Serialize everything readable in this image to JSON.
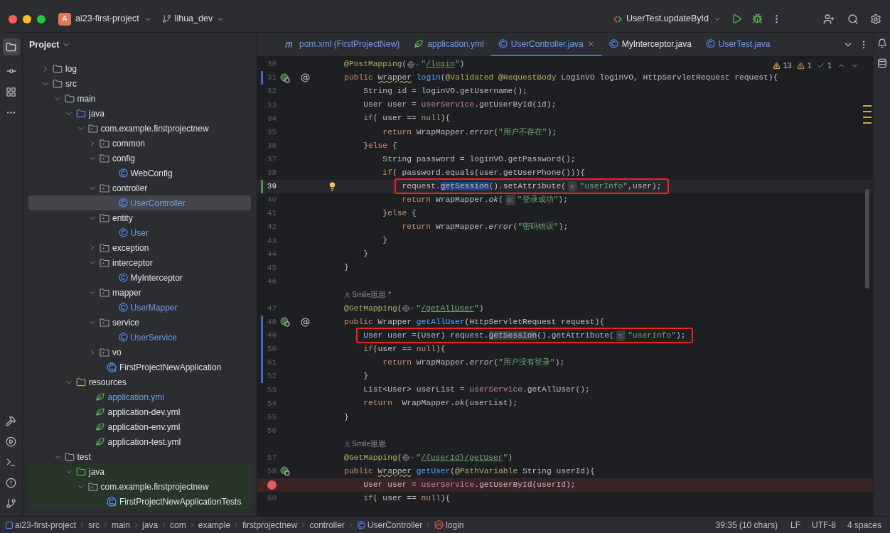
{
  "title_bar": {
    "project": {
      "badge": "A",
      "name": "ai23-first-project"
    },
    "branch": "lihua_dev",
    "run_config": "UserTest.updateById"
  },
  "project_panel": {
    "title": "Project",
    "tree": [
      {
        "label": "log",
        "kind": "folder",
        "expanded": false,
        "selected": false,
        "modified": false
      },
      {
        "label": "src",
        "kind": "folder",
        "expanded": true,
        "selected": false,
        "modified": false,
        "children": [
          {
            "label": "main",
            "kind": "folder",
            "expanded": true,
            "selected": false,
            "modified": false,
            "children": [
              {
                "label": "java",
                "kind": "source",
                "expanded": true,
                "selected": false,
                "modified": false,
                "children": [
                  {
                    "label": "com.example.firstprojectnew",
                    "kind": "package",
                    "expanded": true,
                    "selected": false,
                    "modified": false,
                    "children": [
                      {
                        "label": "common",
                        "kind": "package",
                        "expanded": false,
                        "selected": false,
                        "modified": false
                      },
                      {
                        "label": "config",
                        "kind": "package",
                        "expanded": true,
                        "selected": false,
                        "modified": false,
                        "children": [
                          {
                            "label": "WebConfig",
                            "kind": "class",
                            "selected": false,
                            "modified": false
                          }
                        ]
                      },
                      {
                        "label": "controller",
                        "kind": "package",
                        "expanded": true,
                        "selected": false,
                        "modified": false,
                        "children": [
                          {
                            "label": "UserController",
                            "kind": "class",
                            "selected": true,
                            "modified": true
                          }
                        ]
                      },
                      {
                        "label": "entity",
                        "kind": "package",
                        "expanded": true,
                        "selected": false,
                        "modified": false,
                        "children": [
                          {
                            "label": "User",
                            "kind": "class",
                            "selected": false,
                            "modified": true
                          }
                        ]
                      },
                      {
                        "label": "exception",
                        "kind": "package",
                        "expanded": false,
                        "selected": false,
                        "modified": false
                      },
                      {
                        "label": "interceptor",
                        "kind": "package",
                        "expanded": true,
                        "selected": false,
                        "modified": false,
                        "children": [
                          {
                            "label": "MyInterceptor",
                            "kind": "class",
                            "selected": false,
                            "modified": false
                          }
                        ]
                      },
                      {
                        "label": "mapper",
                        "kind": "package",
                        "expanded": true,
                        "selected": false,
                        "modified": false,
                        "children": [
                          {
                            "label": "UserMapper",
                            "kind": "class",
                            "selected": false,
                            "modified": true
                          }
                        ]
                      },
                      {
                        "label": "service",
                        "kind": "package",
                        "expanded": true,
                        "selected": false,
                        "modified": false,
                        "children": [
                          {
                            "label": "UserService",
                            "kind": "class",
                            "selected": false,
                            "modified": true
                          }
                        ]
                      },
                      {
                        "label": "vo",
                        "kind": "package",
                        "expanded": false,
                        "selected": false,
                        "modified": false
                      },
                      {
                        "label": "FirstProjectNewApplication",
                        "kind": "app",
                        "selected": false,
                        "modified": false
                      }
                    ]
                  }
                ]
              },
              {
                "label": "resources",
                "kind": "resources",
                "expanded": true,
                "selected": false,
                "modified": false,
                "children": [
                  {
                    "label": "application.yml",
                    "kind": "yml",
                    "selected": false,
                    "modified": true
                  },
                  {
                    "label": "application-dev.yml",
                    "kind": "yml",
                    "selected": false,
                    "modified": false
                  },
                  {
                    "label": "application-env.yml",
                    "kind": "yml",
                    "selected": false,
                    "modified": false
                  },
                  {
                    "label": "application-test.yml",
                    "kind": "yml",
                    "selected": false,
                    "modified": false
                  }
                ]
              }
            ]
          },
          {
            "label": "test",
            "kind": "folder",
            "expanded": true,
            "selected": false,
            "modified": false,
            "children": [
              {
                "label": "java",
                "kind": "test-source",
                "expanded": true,
                "selected": false,
                "modified": false,
                "children": [
                  {
                    "label": "com.example.firstprojectnew",
                    "kind": "package",
                    "expanded": true,
                    "selected": false,
                    "modified": false,
                    "children": [
                      {
                        "label": "FirstProjectNewApplicationTests",
                        "kind": "app",
                        "selected": false,
                        "modified": false
                      }
                    ]
                  }
                ]
              }
            ]
          }
        ]
      }
    ]
  },
  "tabs": [
    {
      "label": "pom.xml (FirstProjectNew)",
      "kind": "maven",
      "selected": false,
      "modified": true
    },
    {
      "label": "application.yml",
      "kind": "yml",
      "selected": false,
      "modified": true
    },
    {
      "label": "UserController.java",
      "kind": "class",
      "selected": true,
      "modified": true
    },
    {
      "label": "MyInterceptor.java",
      "kind": "class",
      "selected": false,
      "modified": false
    },
    {
      "label": "UserTest.java",
      "kind": "class",
      "selected": false,
      "modified": true
    }
  ],
  "inspections": {
    "warnings": "13",
    "weak_warnings": "1",
    "typos": "1"
  },
  "editor": {
    "lines": [
      {
        "kind": "code",
        "no": "30",
        "tokens": [
          {
            "kind": "ann",
            "text": "    @PostMapping"
          },
          {
            "kind": "plain",
            "text": "("
          },
          {
            "kind": "globe"
          },
          {
            "kind": "str",
            "text": "\""
          },
          {
            "kind": "link",
            "text": "/login"
          },
          {
            "kind": "str",
            "text": "\""
          },
          {
            "kind": "plain",
            "text": ")"
          }
        ]
      },
      {
        "kind": "code",
        "no": "31",
        "marker": {
          "kind": "modified"
        },
        "gutter": [
          {
            "kind": "bean"
          },
          {
            "kind": "at"
          }
        ],
        "tokens": [
          {
            "kind": "kw",
            "text": "    public "
          },
          {
            "kind": "warn",
            "text": "Wrapper"
          },
          {
            "kind": "fn",
            "text": " login"
          },
          {
            "kind": "plain",
            "text": "("
          },
          {
            "kind": "ann",
            "text": "@Validated @RequestBody "
          },
          {
            "kind": "plain",
            "text": "LoginVO loginVO, HttpServletRequest request){"
          }
        ]
      },
      {
        "kind": "code",
        "no": "32",
        "tokens": [
          {
            "kind": "plain",
            "text": "        String id = loginVO.getUsername();"
          }
        ]
      },
      {
        "kind": "code",
        "no": "33",
        "tokens": [
          {
            "kind": "plain",
            "text": "        User user = "
          },
          {
            "kind": "field",
            "text": "userService"
          },
          {
            "kind": "plain",
            "text": ".getUserById(id);"
          }
        ]
      },
      {
        "kind": "code",
        "no": "34",
        "tokens": [
          {
            "kind": "kw",
            "text": "        if"
          },
          {
            "kind": "plain",
            "text": "( user == "
          },
          {
            "kind": "kw",
            "text": "null"
          },
          {
            "kind": "plain",
            "text": "){"
          }
        ]
      },
      {
        "kind": "code",
        "no": "35",
        "tokens": [
          {
            "kind": "kw",
            "text": "            return "
          },
          {
            "kind": "plain",
            "text": "WrapMapper."
          },
          {
            "kind": "italic",
            "text": "error"
          },
          {
            "kind": "plain",
            "text": "("
          },
          {
            "kind": "str",
            "text": "\"用户不存在\""
          },
          {
            "kind": "plain",
            "text": ");"
          }
        ]
      },
      {
        "kind": "code",
        "no": "36",
        "tokens": [
          {
            "kind": "plain",
            "text": "        }"
          },
          {
            "kind": "kw",
            "text": "else"
          },
          {
            "kind": "plain",
            "text": " {"
          }
        ]
      },
      {
        "kind": "code",
        "no": "37",
        "tokens": [
          {
            "kind": "plain",
            "text": "            String password = loginVO.getPassword();"
          }
        ]
      },
      {
        "kind": "code",
        "no": "38",
        "tokens": [
          {
            "kind": "kw",
            "text": "            if"
          },
          {
            "kind": "plain",
            "text": "( password.equals(user.getUserPhone())){"
          }
        ]
      },
      {
        "kind": "code",
        "no": "39",
        "row": {
          "kind": "current"
        },
        "frame": {
          "kind": "boxed"
        },
        "marker": {
          "kind": "added"
        },
        "gutter": [
          {
            "kind": "bulb"
          }
        ],
        "tokens": [
          {
            "kind": "plain",
            "text": "request."
          },
          {
            "kind": "sel",
            "text": "getSession"
          },
          {
            "kind": "plain",
            "text": "().setAttribute("
          },
          {
            "kind": "hint",
            "text": "s:"
          },
          {
            "kind": "str",
            "text": "\"userInfo\""
          },
          {
            "kind": "plain",
            "text": ",user);"
          }
        ]
      },
      {
        "kind": "code",
        "no": "40",
        "tokens": [
          {
            "kind": "kw",
            "text": "                return "
          },
          {
            "kind": "plain",
            "text": "WrapMapper."
          },
          {
            "kind": "italic",
            "text": "ok"
          },
          {
            "kind": "plain",
            "text": "("
          },
          {
            "kind": "hint",
            "text": "o:"
          },
          {
            "kind": "str",
            "text": "\"登录成功\""
          },
          {
            "kind": "plain",
            "text": ");"
          }
        ]
      },
      {
        "kind": "code",
        "no": "41",
        "tokens": [
          {
            "kind": "plain",
            "text": "            }"
          },
          {
            "kind": "kw",
            "text": "else"
          },
          {
            "kind": "plain",
            "text": " {"
          }
        ]
      },
      {
        "kind": "code",
        "no": "42",
        "tokens": [
          {
            "kind": "kw",
            "text": "                return "
          },
          {
            "kind": "plain",
            "text": "WrapMapper."
          },
          {
            "kind": "italic",
            "text": "error"
          },
          {
            "kind": "plain",
            "text": "("
          },
          {
            "kind": "str",
            "text": "\"密码错误\""
          },
          {
            "kind": "plain",
            "text": ");"
          }
        ]
      },
      {
        "kind": "code",
        "no": "43",
        "tokens": [
          {
            "kind": "plain",
            "text": "            }"
          }
        ]
      },
      {
        "kind": "code",
        "no": "44",
        "tokens": [
          {
            "kind": "plain",
            "text": "        }"
          }
        ]
      },
      {
        "kind": "code",
        "no": "45",
        "tokens": [
          {
            "kind": "plain",
            "text": "    }"
          }
        ]
      },
      {
        "kind": "code",
        "no": "46"
      },
      {
        "kind": "author",
        "text": "Smile崽崽 *"
      },
      {
        "kind": "code",
        "no": "47",
        "tokens": [
          {
            "kind": "ann",
            "text": "    @GetMapping"
          },
          {
            "kind": "plain",
            "text": "("
          },
          {
            "kind": "globe"
          },
          {
            "kind": "str",
            "text": "\""
          },
          {
            "kind": "link",
            "text": "/getAllUser"
          },
          {
            "kind": "str",
            "text": "\""
          },
          {
            "kind": "plain",
            "text": ")"
          }
        ]
      },
      {
        "kind": "code",
        "no": "48",
        "marker": {
          "kind": "modified"
        },
        "gutter": [
          {
            "kind": "bean"
          },
          {
            "kind": "at"
          }
        ],
        "tokens": [
          {
            "kind": "kw",
            "text": "    public "
          },
          {
            "kind": "plain",
            "text": "Wrapper "
          },
          {
            "kind": "fn",
            "text": "getAllUser"
          },
          {
            "kind": "plain",
            "text": "(HttpServletRequest request){"
          }
        ]
      },
      {
        "kind": "code",
        "no": "49",
        "frame": {
          "kind": "boxed"
        },
        "marker": {
          "kind": "modified"
        },
        "tokens": [
          {
            "kind": "plain",
            "text": "User user =(User) request."
          },
          {
            "kind": "usage",
            "text": "getSession"
          },
          {
            "kind": "plain",
            "text": "().getAttribute("
          },
          {
            "kind": "hint",
            "text": "s:"
          },
          {
            "kind": "str",
            "text": "\"userInfo\""
          },
          {
            "kind": "plain",
            "text": ");"
          }
        ]
      },
      {
        "kind": "code",
        "no": "50",
        "marker": {
          "kind": "modified"
        },
        "tokens": [
          {
            "kind": "kw",
            "text": "        if"
          },
          {
            "kind": "plain",
            "text": "(user == "
          },
          {
            "kind": "kw",
            "text": "null"
          },
          {
            "kind": "plain",
            "text": "){"
          }
        ]
      },
      {
        "kind": "code",
        "no": "51",
        "marker": {
          "kind": "modified"
        },
        "tokens": [
          {
            "kind": "kw",
            "text": "            return "
          },
          {
            "kind": "plain",
            "text": "WrapMapper."
          },
          {
            "kind": "italic",
            "text": "error"
          },
          {
            "kind": "plain",
            "text": "("
          },
          {
            "kind": "str",
            "text": "\"用户没有登录\""
          },
          {
            "kind": "plain",
            "text": ");"
          }
        ]
      },
      {
        "kind": "code",
        "no": "52",
        "marker": {
          "kind": "modified"
        },
        "tokens": [
          {
            "kind": "plain",
            "text": "        }"
          }
        ]
      },
      {
        "kind": "code",
        "no": "53",
        "tokens": [
          {
            "kind": "plain",
            "text": "        List<User> userList = "
          },
          {
            "kind": "field",
            "text": "userService"
          },
          {
            "kind": "plain",
            "text": ".getAllUser();"
          }
        ]
      },
      {
        "kind": "code",
        "no": "54",
        "tokens": [
          {
            "kind": "kw",
            "text": "        return  "
          },
          {
            "kind": "plain",
            "text": "WrapMapper."
          },
          {
            "kind": "italic",
            "text": "ok"
          },
          {
            "kind": "plain",
            "text": "(userList);"
          }
        ]
      },
      {
        "kind": "code",
        "no": "55",
        "tokens": [
          {
            "kind": "plain",
            "text": "    }"
          }
        ]
      },
      {
        "kind": "code",
        "no": "56"
      },
      {
        "kind": "author",
        "text": "Smile崽崽"
      },
      {
        "kind": "code",
        "no": "57",
        "tokens": [
          {
            "kind": "ann",
            "text": "    @GetMapping"
          },
          {
            "kind": "plain",
            "text": "("
          },
          {
            "kind": "globe"
          },
          {
            "kind": "str",
            "text": "\""
          },
          {
            "kind": "link",
            "text": "/{userId}/getUser"
          },
          {
            "kind": "str",
            "text": "\""
          },
          {
            "kind": "plain",
            "text": ")"
          }
        ]
      },
      {
        "kind": "code",
        "no": "58",
        "gutter": [
          {
            "kind": "bean"
          }
        ],
        "tokens": [
          {
            "kind": "kw",
            "text": "    public "
          },
          {
            "kind": "warn",
            "text": "Wrapper"
          },
          {
            "kind": "fn",
            "text": " getUser"
          },
          {
            "kind": "plain",
            "text": "("
          },
          {
            "kind": "ann",
            "text": "@PathVariable "
          },
          {
            "kind": "plain",
            "text": "String userId){"
          }
        ]
      },
      {
        "kind": "code",
        "row": {
          "kind": "breakpoint"
        },
        "tokens": [
          {
            "kind": "plain",
            "text": "        User user = "
          },
          {
            "kind": "field",
            "text": "userService"
          },
          {
            "kind": "plain",
            "text": ".getUserById(userId);"
          }
        ]
      },
      {
        "kind": "code",
        "no": "60",
        "tokens": [
          {
            "kind": "kw",
            "text": "        if"
          },
          {
            "kind": "plain",
            "text": "( user == "
          },
          {
            "kind": "kw",
            "text": "null"
          },
          {
            "kind": "plain",
            "text": "){"
          }
        ]
      }
    ]
  },
  "status_bar": {
    "breadcrumbs": [
      {
        "label": "ai23-first-project",
        "kind": "module"
      },
      {
        "label": "src",
        "kind": "plain"
      },
      {
        "label": "main",
        "kind": "plain"
      },
      {
        "label": "java",
        "kind": "plain"
      },
      {
        "label": "com",
        "kind": "plain"
      },
      {
        "label": "example",
        "kind": "plain"
      },
      {
        "label": "firstprojectnew",
        "kind": "plain"
      },
      {
        "label": "controller",
        "kind": "plain"
      },
      {
        "label": "UserController",
        "kind": "class"
      },
      {
        "label": "login",
        "kind": "method"
      }
    ],
    "position": "39:35 (10 chars)",
    "line_separator": "LF",
    "encoding": "UTF-8",
    "indent": "4 spaces"
  }
}
